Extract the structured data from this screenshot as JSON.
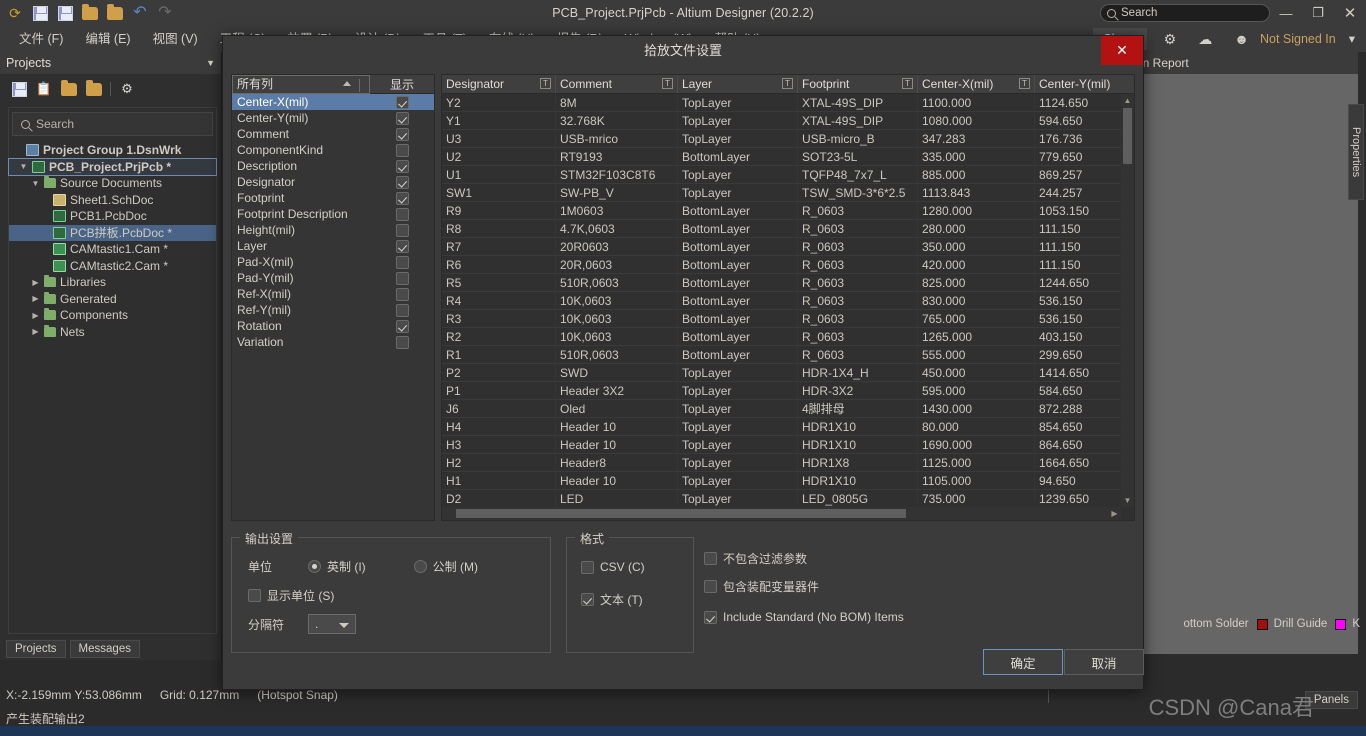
{
  "app": {
    "title": "PCB_Project.PrjPcb - Altium Designer (20.2.2)",
    "search_placeholder": "Search",
    "account_label": "Not Signed In",
    "share_label": "Share"
  },
  "window_controls": {
    "minimize": "—",
    "maximize": "❐",
    "close": "✕"
  },
  "toolbar_icons": [
    {
      "name": "open-recent-icon",
      "glyph": "⟲"
    },
    {
      "name": "save-icon",
      "glyph": ""
    },
    {
      "name": "save-all-icon",
      "glyph": ""
    },
    {
      "name": "open-folder-icon",
      "glyph": ""
    },
    {
      "name": "open-project-icon",
      "glyph": ""
    },
    {
      "name": "undo-icon",
      "glyph": "↶"
    },
    {
      "name": "redo-icon",
      "glyph": "↷"
    }
  ],
  "menubar": [
    {
      "label": "文件 (F)"
    },
    {
      "label": "编辑 (E)"
    },
    {
      "label": "视图 (V)"
    },
    {
      "label": "工程 (C)"
    },
    {
      "label": "放置 (P)"
    },
    {
      "label": "设计 (D)"
    },
    {
      "label": "工具 (T)"
    },
    {
      "label": "布线 (U)"
    },
    {
      "label": "报告 (R)"
    },
    {
      "label": "Window (W)"
    },
    {
      "label": "帮助 (H)"
    }
  ],
  "projects_panel": {
    "title": "Projects",
    "collapse_icon": "▼",
    "search_placeholder": "Search",
    "toolbar_icons": [
      "save-icon",
      "copy-icon",
      "open-project-icon",
      "project-options-icon",
      "settings-gear-icon"
    ],
    "tree": [
      {
        "label": "Project Group 1.DsnWrk",
        "indent": 0,
        "icon": "ic-wrk",
        "twist": "",
        "state": "none"
      },
      {
        "label": "PCB_Project.PrjPcb *",
        "indent": 1,
        "icon": "ic-prj",
        "twist": "▼",
        "state": "outline"
      },
      {
        "label": "Source Documents",
        "indent": 2,
        "icon": "folder",
        "twist": "▼",
        "state": "none"
      },
      {
        "label": "Sheet1.SchDoc",
        "indent": 3,
        "icon": "ic-sch",
        "twist": "",
        "state": "none"
      },
      {
        "label": "PCB1.PcbDoc",
        "indent": 3,
        "icon": "ic-pcb",
        "twist": "",
        "state": "none"
      },
      {
        "label": "PCB拼板.PcbDoc *",
        "indent": 3,
        "icon": "ic-pcb",
        "twist": "",
        "state": "selected"
      },
      {
        "label": "CAMtastic1.Cam *",
        "indent": 3,
        "icon": "ic-cam",
        "twist": "",
        "state": "none"
      },
      {
        "label": "CAMtastic2.Cam *",
        "indent": 3,
        "icon": "ic-cam",
        "twist": "",
        "state": "none"
      },
      {
        "label": "Libraries",
        "indent": 2,
        "icon": "folder",
        "twist": "▶",
        "state": "none"
      },
      {
        "label": "Generated",
        "indent": 2,
        "icon": "folder",
        "twist": "▶",
        "state": "none"
      },
      {
        "label": "Components",
        "indent": 2,
        "icon": "folder",
        "twist": "▶",
        "state": "none"
      },
      {
        "label": "Nets",
        "indent": 2,
        "icon": "folder",
        "twist": "▶",
        "state": "none"
      }
    ],
    "tabs": [
      {
        "label": "Projects"
      },
      {
        "label": "Messages"
      }
    ]
  },
  "editor": {
    "report_tab_label": "on Report",
    "properties_tab_label": "Properties",
    "panels_button": "Panels",
    "layers": [
      {
        "label": "ottom Solder",
        "color": ""
      },
      {
        "label": "Drill Guide",
        "color": "#a01010"
      },
      {
        "label": "K",
        "color": "#ff00ff"
      }
    ]
  },
  "statusbar": {
    "coords": "X:-2.159mm  Y:53.086mm",
    "grid": "Grid: 0.127mm",
    "snap": "(Hotspot Snap)",
    "task": "产生装配输出2"
  },
  "watermark": "CSDN @Cana君",
  "dialog": {
    "title": "拾放文件设置",
    "close_glyph": "✕",
    "column_list": {
      "header_all": "所有列",
      "header_show": "显示",
      "sort_caret": "▲",
      "rows": [
        {
          "name": "Center-X(mil)",
          "checked": true,
          "selected": true
        },
        {
          "name": "Center-Y(mil)",
          "checked": true,
          "selected": false
        },
        {
          "name": "Comment",
          "checked": true,
          "selected": false
        },
        {
          "name": "ComponentKind",
          "checked": false,
          "selected": false
        },
        {
          "name": "Description",
          "checked": true,
          "selected": false
        },
        {
          "name": "Designator",
          "checked": true,
          "selected": false
        },
        {
          "name": "Footprint",
          "checked": true,
          "selected": false
        },
        {
          "name": "Footprint Description",
          "checked": false,
          "selected": false
        },
        {
          "name": "Height(mil)",
          "checked": false,
          "selected": false
        },
        {
          "name": "Layer",
          "checked": true,
          "selected": false
        },
        {
          "name": "Pad-X(mil)",
          "checked": false,
          "selected": false
        },
        {
          "name": "Pad-Y(mil)",
          "checked": false,
          "selected": false
        },
        {
          "name": "Ref-X(mil)",
          "checked": false,
          "selected": false
        },
        {
          "name": "Ref-Y(mil)",
          "checked": false,
          "selected": false
        },
        {
          "name": "Rotation",
          "checked": true,
          "selected": false
        },
        {
          "name": "Variation",
          "checked": false,
          "selected": false
        }
      ]
    },
    "grid": {
      "filter_glyph": "T",
      "columns": [
        {
          "label": "Designator",
          "width": 114,
          "filter": true
        },
        {
          "label": "Comment",
          "width": 122,
          "filter": true
        },
        {
          "label": "Layer",
          "width": 120,
          "filter": true
        },
        {
          "label": "Footprint",
          "width": 120,
          "filter": true
        },
        {
          "label": "Center-X(mil)",
          "width": 117,
          "filter": true
        },
        {
          "label": "Center-Y(mil)",
          "width": 114,
          "filter": false
        }
      ],
      "rows": [
        [
          "Y2",
          "8M",
          "TopLayer",
          "XTAL-49S_DIP",
          "1100.000",
          "1124.650"
        ],
        [
          "Y1",
          "32.768K",
          "TopLayer",
          "XTAL-49S_DIP",
          "1080.000",
          "594.650"
        ],
        [
          "U3",
          "USB-mrico",
          "TopLayer",
          "USB-micro_B",
          "347.283",
          "176.736"
        ],
        [
          "U2",
          "RT9193",
          "BottomLayer",
          "SOT23-5L",
          "335.000",
          "779.650"
        ],
        [
          "U1",
          "STM32F103C8T6",
          "TopLayer",
          "TQFP48_7x7_L",
          "885.000",
          "869.257"
        ],
        [
          "SW1",
          "SW-PB_V",
          "TopLayer",
          "TSW_SMD-3*6*2.5",
          "1113.843",
          "244.257"
        ],
        [
          "R9",
          "1M0603",
          "BottomLayer",
          "R_0603",
          "1280.000",
          "1053.150"
        ],
        [
          "R8",
          "4.7K,0603",
          "BottomLayer",
          "R_0603",
          "280.000",
          "111.150"
        ],
        [
          "R7",
          "20R0603",
          "BottomLayer",
          "R_0603",
          "350.000",
          "111.150"
        ],
        [
          "R6",
          "20R,0603",
          "BottomLayer",
          "R_0603",
          "420.000",
          "111.150"
        ],
        [
          "R5",
          "510R,0603",
          "BottomLayer",
          "R_0603",
          "825.000",
          "1244.650"
        ],
        [
          "R4",
          "10K,0603",
          "BottomLayer",
          "R_0603",
          "830.000",
          "536.150"
        ],
        [
          "R3",
          "10K,0603",
          "BottomLayer",
          "R_0603",
          "765.000",
          "536.150"
        ],
        [
          "R2",
          "10K,0603",
          "BottomLayer",
          "R_0603",
          "1265.000",
          "403.150"
        ],
        [
          "R1",
          "510R,0603",
          "BottomLayer",
          "R_0603",
          "555.000",
          "299.650"
        ],
        [
          "P2",
          "SWD",
          "TopLayer",
          "HDR-1X4_H",
          "450.000",
          "1414.650"
        ],
        [
          "P1",
          "Header 3X2",
          "TopLayer",
          "HDR-3X2",
          "595.000",
          "584.650"
        ],
        [
          "J6",
          "Oled",
          "TopLayer",
          "4脚排母",
          "1430.000",
          "872.288"
        ],
        [
          "H4",
          "Header 10",
          "TopLayer",
          "HDR1X10",
          "80.000",
          "854.650"
        ],
        [
          "H3",
          "Header 10",
          "TopLayer",
          "HDR1X10",
          "1690.000",
          "864.650"
        ],
        [
          "H2",
          "Header8",
          "TopLayer",
          "HDR1X8",
          "1125.000",
          "1664.650"
        ],
        [
          "H1",
          "Header 10",
          "TopLayer",
          "HDR1X10",
          "1105.000",
          "94.650"
        ],
        [
          "D2",
          "LED",
          "TopLayer",
          "LED_0805G",
          "735.000",
          "1239.650"
        ]
      ]
    },
    "output_settings": {
      "legend": "输出设置",
      "unit_label": "单位",
      "unit_imperial": "英制 (I)",
      "unit_metric": "公制 (M)",
      "unit_selected": "imperial",
      "show_units_label": "显示单位 (S)",
      "show_units_checked": false,
      "separator_label": "分隔符",
      "separator_value": "."
    },
    "format_settings": {
      "legend": "格式",
      "csv_label": "CSV (C)",
      "csv_checked": false,
      "text_label": "文本 (T)",
      "text_checked": true
    },
    "extra_options": [
      {
        "label": "不包含过滤参数",
        "checked": false
      },
      {
        "label": "包含装配变量器件",
        "checked": false
      },
      {
        "label": "Include Standard (No BOM) Items",
        "checked": true
      }
    ],
    "buttons": {
      "ok": "确定",
      "cancel": "取消"
    }
  }
}
